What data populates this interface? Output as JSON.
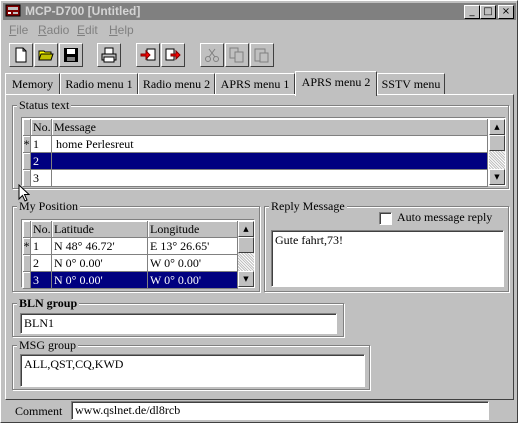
{
  "window": {
    "title": "MCP-D700 [Untitled]",
    "controls": {
      "minimize": "_",
      "maximize": "□",
      "close": "×"
    }
  },
  "menu": [
    {
      "label": "File",
      "mnemonic": "F",
      "rest": "ile"
    },
    {
      "label": "Radio",
      "mnemonic": "R",
      "rest": "adio"
    },
    {
      "label": "Edit",
      "mnemonic": "E",
      "rest": "dit"
    },
    {
      "label": "Help",
      "mnemonic": "H",
      "rest": "elp"
    }
  ],
  "toolbar": {
    "icons": [
      "new-file-icon",
      "open-folder-icon",
      "save-disk-icon",
      "print-icon",
      "read-from-radio-icon",
      "write-to-radio-icon",
      "cut-icon",
      "copy-icon",
      "paste-icon"
    ]
  },
  "tabs": [
    "Memory",
    "Radio menu 1",
    "Radio menu 2",
    "APRS menu 1",
    "APRS menu 2",
    "SSTV menu"
  ],
  "active_tab": "APRS menu 2",
  "status_text": {
    "label": "Status text",
    "columns": [
      "No.",
      "Message"
    ],
    "rows": [
      {
        "marker": "*",
        "no": "1",
        "message": "home Perlesreut",
        "selected": false
      },
      {
        "marker": "",
        "no": "2",
        "message": "",
        "selected": true
      },
      {
        "marker": "",
        "no": "3",
        "message": "",
        "selected": false
      }
    ]
  },
  "my_position": {
    "label": "My Position",
    "columns": [
      "No.",
      "Latitude",
      "Longitude"
    ],
    "rows": [
      {
        "marker": "*",
        "no": "1",
        "latitude": "N 48° 46.72'",
        "longitude": "E  13° 26.65'",
        "selected": false
      },
      {
        "marker": "",
        "no": "2",
        "latitude": "N  0° 0.00'",
        "longitude": "W   0° 0.00'",
        "selected": false
      },
      {
        "marker": "",
        "no": "3",
        "latitude": "N  0° 0.00'",
        "longitude": "W   0° 0.00'",
        "selected": true
      }
    ]
  },
  "reply_message": {
    "label": "Reply Message",
    "auto_label": "Auto message reply",
    "auto_checked": false,
    "text": "Gute fahrt,73!"
  },
  "bln_group": {
    "label": "BLN group",
    "value": "BLN1"
  },
  "msg_group": {
    "label": "MSG group",
    "value": "ALL,QST,CQ,KWD"
  },
  "comment": {
    "label": "Comment",
    "value": "www.qslnet.de/dl8rcb"
  },
  "colors": {
    "selection": "#000080",
    "face": "#c0c0c0",
    "title_inactive": "#808080"
  }
}
